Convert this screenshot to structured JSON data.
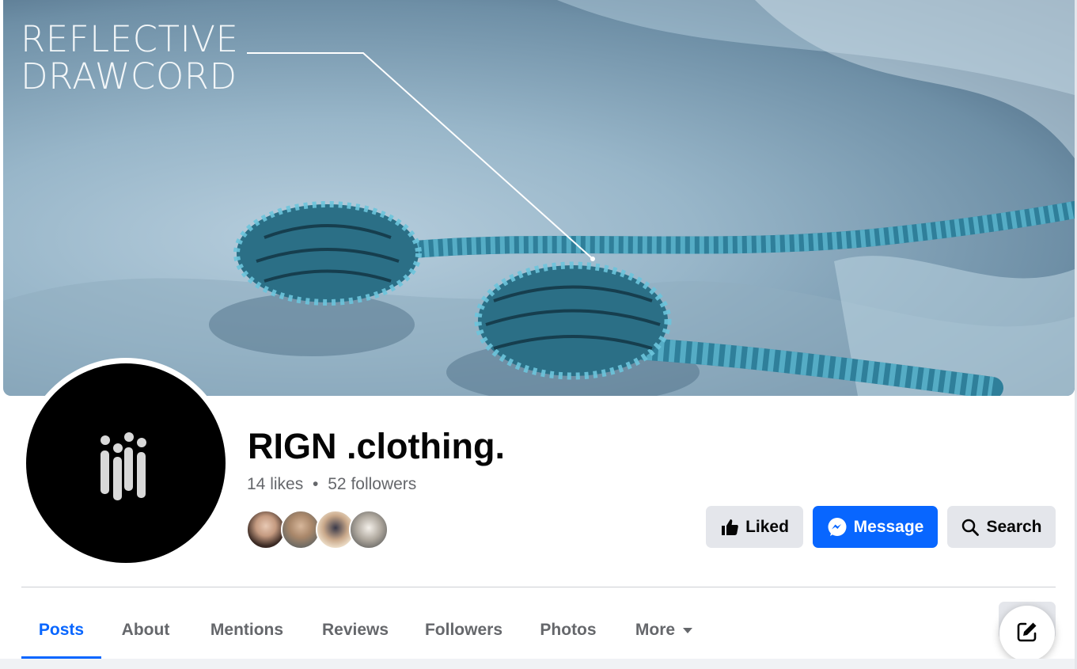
{
  "cover": {
    "text_line1": "REFLECTIVE",
    "text_line2": "DRAWCORD"
  },
  "page": {
    "name": "RIGN .clothing.",
    "likes": "14 likes",
    "separator": "•",
    "followers": "52 followers"
  },
  "actions": {
    "liked_label": "Liked",
    "message_label": "Message",
    "search_label": "Search"
  },
  "tabs": [
    {
      "label": "Posts",
      "active": true
    },
    {
      "label": "About"
    },
    {
      "label": "Mentions"
    },
    {
      "label": "Reviews"
    },
    {
      "label": "Followers"
    },
    {
      "label": "Photos"
    },
    {
      "label": "More"
    }
  ],
  "colors": {
    "accent": "#0866ff",
    "button_gray": "#e4e6eb",
    "secondary_text": "#65676b"
  },
  "icons": {
    "liked": "thumbs-up-icon",
    "message": "messenger-icon",
    "search": "search-icon",
    "more": "caret-down-icon",
    "compose": "edit-icon"
  }
}
